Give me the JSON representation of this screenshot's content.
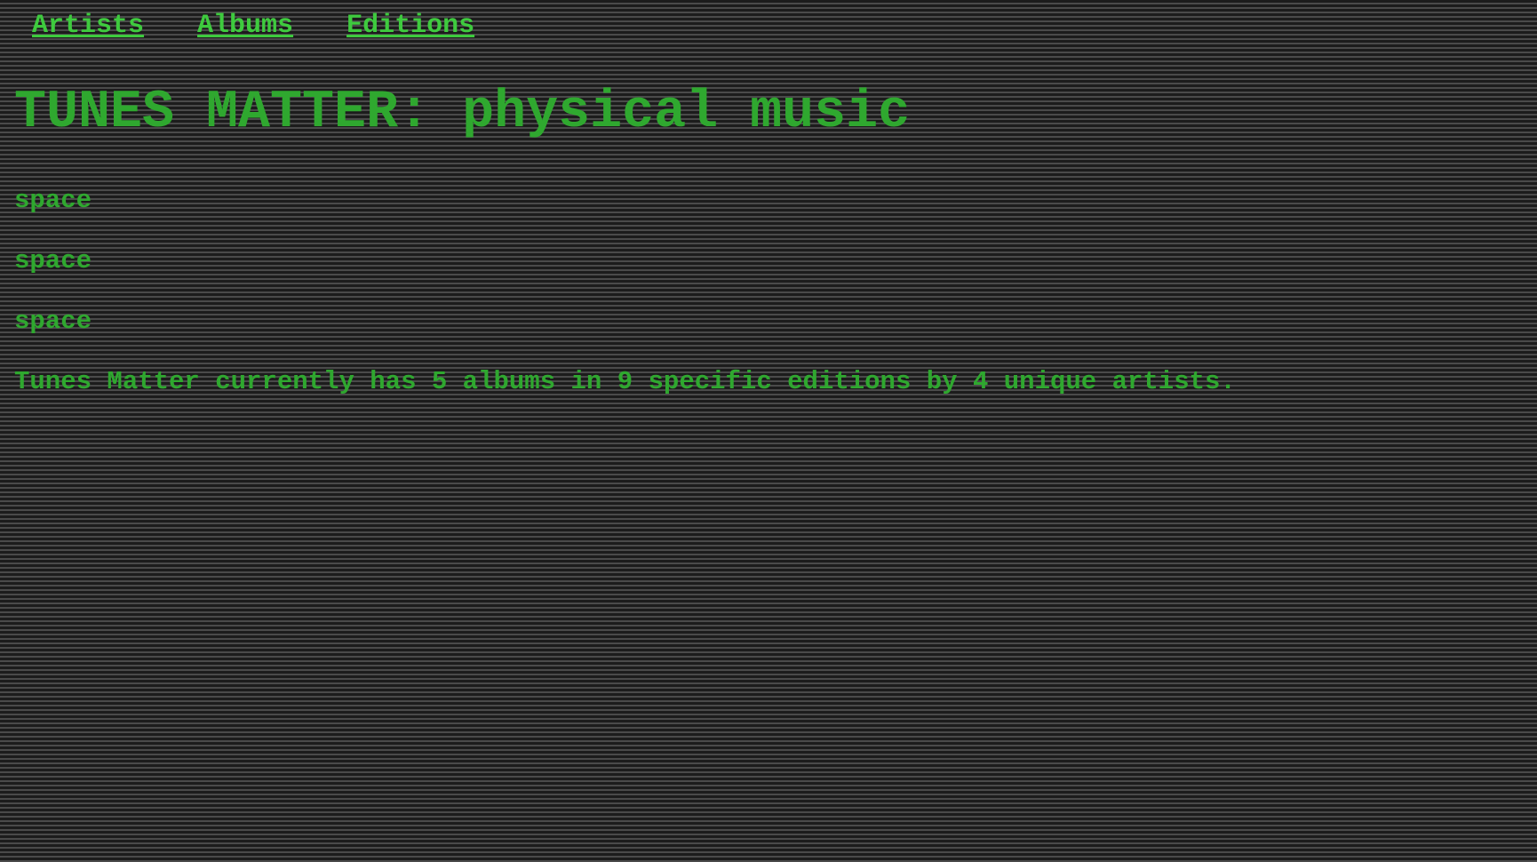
{
  "nav": {
    "items": [
      {
        "label": "Artists"
      },
      {
        "label": "Albums"
      },
      {
        "label": "Editions"
      }
    ]
  },
  "header": {
    "title": "TUNES MATTER: physical music"
  },
  "main": {
    "spacers": [
      "space",
      "space",
      "space"
    ],
    "summary": "Tunes Matter currently has 5 albums in 9 specific editions by 4 unique artists."
  },
  "colors": {
    "text": "#2fa82f",
    "link": "#3ecb3e",
    "background": "#2b2b2b"
  }
}
